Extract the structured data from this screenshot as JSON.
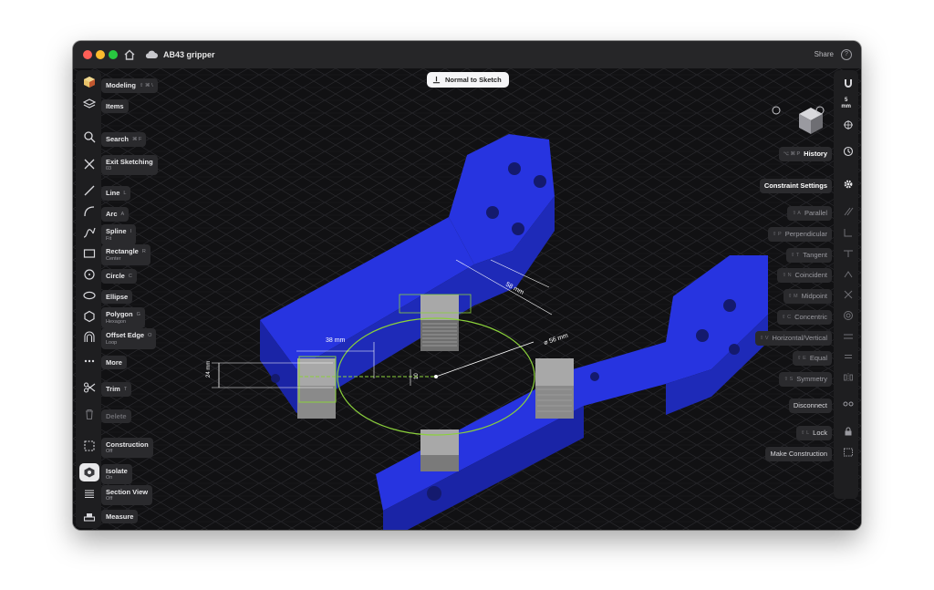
{
  "window": {
    "title": "AB43 gripper",
    "share_label": "Share",
    "help_label": "?",
    "traffic_colors": [
      "#ff5f57",
      "#febc2e",
      "#28c840"
    ]
  },
  "colors": {
    "model_blue": "#2531d8",
    "sketch_green": "#8bd13b",
    "viewport_bg": "#111113"
  },
  "normal_to_sketch": "Normal to Sketch",
  "dimensions": {
    "d1": "58 mm",
    "d2": "38 mm",
    "d3": "⌀ 56 mm",
    "d4": "24 mm",
    "d5": "10"
  },
  "left_tools": [
    {
      "label": "Modeling",
      "shortcut": "⇧ ⌘ \\",
      "icon": "cube-icon"
    },
    {
      "label": "Items",
      "icon": "layers-icon"
    },
    {
      "label": "Search",
      "shortcut": "⌘ F",
      "icon": "search-icon"
    },
    {
      "label": "Exit Sketching",
      "sub": "03",
      "icon": "close-icon"
    },
    {
      "label": "Line",
      "shortcut": "L",
      "icon": "line-icon"
    },
    {
      "label": "Arc",
      "shortcut": "A",
      "icon": "arc-icon"
    },
    {
      "label": "Spline",
      "shortcut": "I",
      "sub": "Fit",
      "icon": "spline-icon"
    },
    {
      "label": "Rectangle",
      "shortcut": "R",
      "sub": "Center",
      "icon": "rectangle-icon"
    },
    {
      "label": "Circle",
      "shortcut": "C",
      "icon": "circle-icon"
    },
    {
      "label": "Ellipse",
      "icon": "ellipse-icon"
    },
    {
      "label": "Polygon",
      "shortcut": "G",
      "sub": "Hexagon",
      "icon": "hexagon-icon"
    },
    {
      "label": "Offset Edge",
      "shortcut": "O",
      "sub": "Loop",
      "icon": "offset-edge-icon"
    },
    {
      "label": "More",
      "icon": "more-icon"
    },
    {
      "label": "Trim",
      "shortcut": "T",
      "icon": "scissors-icon"
    },
    {
      "label": "Delete",
      "icon": "trash-icon"
    },
    {
      "label": "Construction",
      "sub": "Off",
      "icon": "construction-icon"
    },
    {
      "label": "Isolate",
      "sub": "On",
      "icon": "isolate-icon"
    },
    {
      "label": "Section View",
      "sub": "Off",
      "icon": "section-view-icon"
    },
    {
      "label": "Measure",
      "icon": "measure-icon"
    }
  ],
  "right_panel": {
    "grid_value": "5",
    "grid_unit": "mm",
    "history_label": "History",
    "history_shortcut": "⌥ ⌘ P",
    "constraint_settings": "Constraint Settings",
    "constraints": [
      {
        "label": "Parallel",
        "shortcut": "⇧ A",
        "icon": "parallel-icon"
      },
      {
        "label": "Perpendicular",
        "shortcut": "⇧ P",
        "icon": "perpendicular-icon"
      },
      {
        "label": "Tangent",
        "shortcut": "⇧ T",
        "icon": "tangent-icon"
      },
      {
        "label": "Coincident",
        "shortcut": "⇧ N",
        "icon": "coincident-icon"
      },
      {
        "label": "Midpoint",
        "shortcut": "⇧ M",
        "icon": "midpoint-icon"
      },
      {
        "label": "Concentric",
        "shortcut": "⇧ C",
        "icon": "concentric-icon"
      },
      {
        "label": "Horizontal/Vertical",
        "shortcut": "⇧ V",
        "icon": "horizontal-vertical-icon"
      },
      {
        "label": "Equal",
        "shortcut": "⇧ E",
        "icon": "equal-icon"
      },
      {
        "label": "Symmetry",
        "shortcut": "⇧ S",
        "icon": "symmetry-icon"
      },
      {
        "label": "Disconnect",
        "icon": "disconnect-icon"
      },
      {
        "label": "Lock",
        "shortcut": "⇧ L",
        "icon": "lock-icon"
      },
      {
        "label": "Make Construction",
        "icon": "make-construction-icon"
      }
    ]
  }
}
